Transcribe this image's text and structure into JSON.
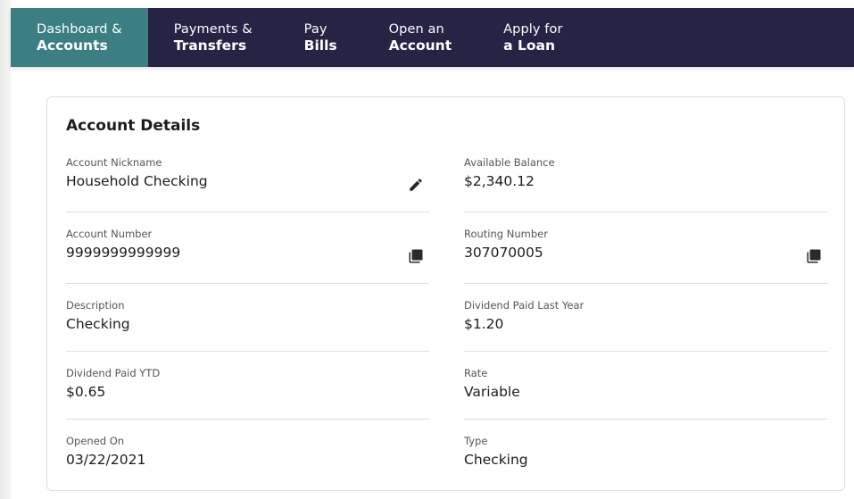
{
  "nav": {
    "items": [
      {
        "line1": "Dashboard &",
        "line2": "Accounts",
        "active": true
      },
      {
        "line1": "Payments &",
        "line2": "Transfers",
        "active": false
      },
      {
        "line1": "Pay",
        "line2": "Bills",
        "active": false
      },
      {
        "line1": "Open an",
        "line2": "Account",
        "active": false
      },
      {
        "line1": "Apply for",
        "line2": "a Loan",
        "active": false
      }
    ]
  },
  "card": {
    "title": "Account Details",
    "left": [
      {
        "label": "Account Nickname",
        "value": "Household Checking",
        "action_icon": "pencil-icon"
      },
      {
        "label": "Account Number",
        "value": "9999999999999",
        "action_icon": "copy-icon"
      },
      {
        "label": "Description",
        "value": "Checking"
      },
      {
        "label": "Dividend Paid YTD",
        "value": "$0.65"
      },
      {
        "label": "Opened On",
        "value": "03/22/2021"
      }
    ],
    "right": [
      {
        "label": "Available Balance",
        "value": "$2,340.12"
      },
      {
        "label": "Routing Number",
        "value": "307070005",
        "action_icon": "copy-icon"
      },
      {
        "label": "Dividend Paid Last Year",
        "value": "$1.20"
      },
      {
        "label": "Rate",
        "value": "Variable"
      },
      {
        "label": "Type",
        "value": "Checking"
      }
    ]
  },
  "colors": {
    "nav_bg": "#272345",
    "nav_active_bg": "#3b7f82",
    "divider": "#dedede"
  }
}
